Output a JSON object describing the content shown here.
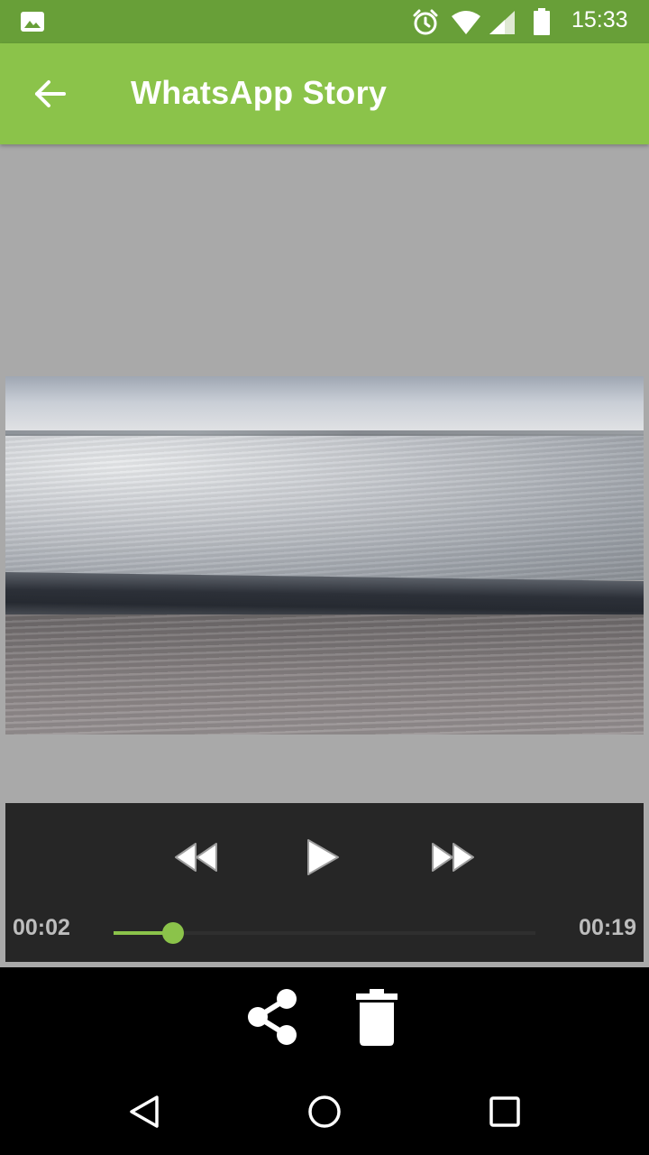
{
  "status_bar": {
    "time": "15:33",
    "icons": [
      "gallery-icon",
      "alarm-icon",
      "wifi-icon",
      "signal-icon",
      "battery-icon"
    ]
  },
  "app_bar": {
    "title": "WhatsApp Story",
    "back_icon": "arrow-left-icon",
    "color": "#8bc34a"
  },
  "player": {
    "current_time": "00:02",
    "duration": "00:19",
    "progress_fraction": 0.14,
    "accent_color": "#8bc34a",
    "controls": [
      "rewind-icon",
      "play-icon",
      "fast-forward-icon"
    ]
  },
  "actions": {
    "icons": [
      "share-icon",
      "delete-icon"
    ]
  },
  "nav_bar": {
    "icons": [
      "nav-back-icon",
      "nav-home-icon",
      "nav-recents-icon"
    ]
  }
}
